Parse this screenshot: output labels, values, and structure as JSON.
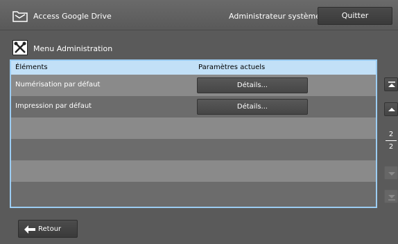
{
  "header": {
    "app_title": "Access Google Drive",
    "user_label": "Administrateur système",
    "quit_label": "Quitter"
  },
  "section": {
    "title": "Menu Administration",
    "icon": "tools-icon"
  },
  "table": {
    "columns": [
      "Éléments",
      "Paramètres actuels"
    ],
    "rows": [
      {
        "label": "Numérisation par défaut",
        "action": "Détails..."
      },
      {
        "label": "Impression par défaut",
        "action": "Détails..."
      }
    ]
  },
  "pagination": {
    "current": "2",
    "total": "2"
  },
  "footer": {
    "back_label": "Retour"
  },
  "colors": {
    "accent": "#9ccdf3",
    "header_row": "#c2e0f7",
    "background": "#5a5a5a"
  }
}
